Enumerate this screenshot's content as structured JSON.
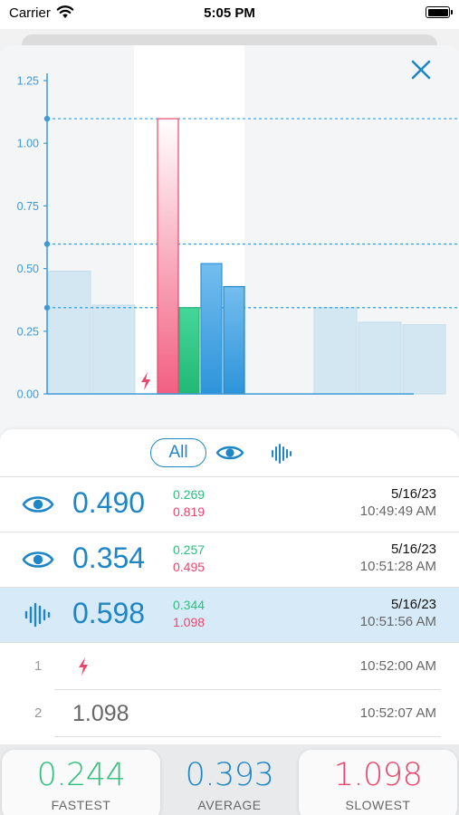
{
  "status_bar": {
    "carrier": "Carrier",
    "time": "5:05 PM"
  },
  "chart_data": {
    "type": "bar",
    "ylim": [
      0,
      1.25
    ],
    "y_ticks": [
      "1.25",
      "1.00",
      "0.75",
      "0.50",
      "0.25",
      "0.00"
    ],
    "reference_lines": [
      1.098,
      0.598,
      0.344
    ],
    "background_bars": [
      0.49,
      0.354,
      null,
      null,
      null,
      null,
      0.344,
      0.286,
      0.276
    ],
    "highlight_bars": [
      {
        "value": 1.098,
        "color": "#f25f81"
      },
      {
        "value": 0.344,
        "color": "#34c98a"
      },
      {
        "value": 0.52,
        "color": "#4aa8e4"
      },
      {
        "value": 0.428,
        "color": "#2d94da"
      }
    ],
    "marker_icon": "bolt-icon",
    "colors": {
      "axis": "#3d9ad9",
      "ghost_bar": "#d3e7f3",
      "slowest": "#e8476d",
      "fastest": "#2dbf7d",
      "accent": "#1f86c6"
    }
  },
  "filter": {
    "all_label": "All",
    "eye_icon": "eye-icon",
    "wave_icon": "waveform-icon"
  },
  "rows": [
    {
      "icon": "eye-icon",
      "main": "0.490",
      "min": "0.269",
      "max": "0.819",
      "date": "5/16/23",
      "time": "10:49:49 AM"
    },
    {
      "icon": "eye-icon",
      "main": "0.354",
      "min": "0.257",
      "max": "0.495",
      "date": "5/16/23",
      "time": "10:51:28 AM"
    },
    {
      "icon": "waveform-icon",
      "main": "0.598",
      "min": "0.344",
      "max": "1.098",
      "date": "5/16/23",
      "time": "10:51:56 AM"
    }
  ],
  "laps": [
    {
      "num": "1",
      "value": "",
      "time": "10:52:00 AM",
      "icon": "bolt-icon"
    },
    {
      "num": "2",
      "value": "1.098",
      "time": "10:52:07 AM"
    }
  ],
  "stats": {
    "fastest": {
      "value": "0.244",
      "label": "FASTEST",
      "color": "#2dbf7d"
    },
    "average": {
      "value": "0.393",
      "label": "AVERAGE",
      "color": "#1f86c6"
    },
    "slowest": {
      "value": "1.098",
      "label": "SLOWEST",
      "color": "#e8476d"
    }
  }
}
